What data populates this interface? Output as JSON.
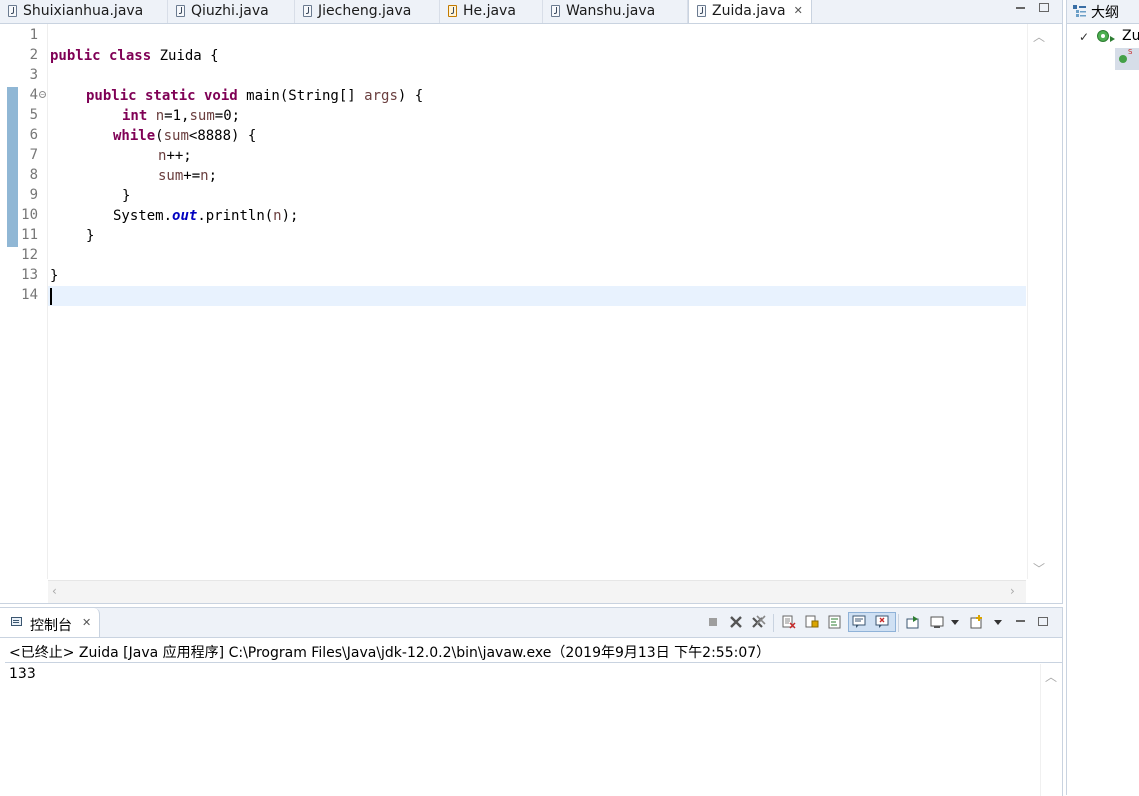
{
  "editor": {
    "tabs": [
      {
        "label": "Shuixianhua.java",
        "active": false,
        "icon": "java-file-icon"
      },
      {
        "label": "Qiuzhi.java",
        "active": false,
        "icon": "java-file-icon"
      },
      {
        "label": "Jiecheng.java",
        "active": false,
        "icon": "java-file-icon"
      },
      {
        "label": "He.java",
        "active": false,
        "icon": "java-file-warning-icon"
      },
      {
        "label": "Wanshu.java",
        "active": false,
        "icon": "java-file-icon"
      },
      {
        "label": "Zuida.java",
        "active": true,
        "icon": "java-file-icon"
      }
    ],
    "close_glyph": "✕",
    "line_numbers": [
      "1",
      "2",
      "3",
      "4",
      "5",
      "6",
      "7",
      "8",
      "9",
      "10",
      "11",
      "12",
      "13",
      "14"
    ],
    "code": {
      "l2_kw": "public class",
      "l2_rest": " Zuida {",
      "l4_kw": "public static void",
      "l4_mid": " main(String[] ",
      "l4_var": "args",
      "l4_end": ") {",
      "l5_kw": "int",
      "l5_var1": "n",
      "l5_mid": "=1,",
      "l5_var2": "sum",
      "l5_end": "=0;",
      "l6_kw": "while",
      "l6_open": "(",
      "l6_var": "sum",
      "l6_end": "<8888) {",
      "l7_var": "n",
      "l7_end": "++;",
      "l8_var1": "sum",
      "l8_mid": "+=",
      "l8_var2": "n",
      "l8_end": ";",
      "l9": "}",
      "l10_pre": "System.",
      "l10_field": "out",
      "l10_mid": ".println(",
      "l10_var": "n",
      "l10_end": ");",
      "l11": "}",
      "l13": "}"
    }
  },
  "outline": {
    "title": "大纲",
    "class_label": "Zu",
    "method_badge": "S"
  },
  "console": {
    "title": "控制台",
    "close_glyph": "✕",
    "status": "<已终止> Zuida [Java 应用程序] C:\\Program Files\\Java\\jdk-12.0.2\\bin\\javaw.exe（2019年9月13日 下午2:55:07）",
    "output": "133"
  },
  "colors": {
    "keyword": "#7f0055",
    "variable": "#6a3e3e",
    "static_field": "#0000c0",
    "current_line": "#e8f2fe",
    "tab_bar": "#eef2f8"
  }
}
